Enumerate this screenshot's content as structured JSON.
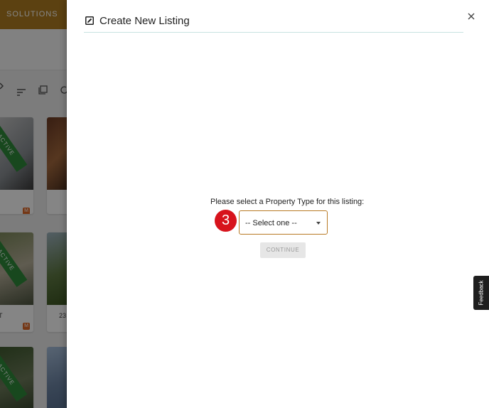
{
  "background": {
    "nav_label": "SOLUTIONS",
    "cards": [
      {
        "status": "ACTIVE",
        "meta": "®]"
      },
      {
        "status": "",
        "meta": ""
      },
      {
        "status": "ACTIVE",
        "meta": "T"
      },
      {
        "status": "",
        "meta": "23"
      },
      {
        "status": "ACTIVE",
        "meta": ""
      },
      {
        "status": "",
        "meta": ""
      }
    ]
  },
  "drawer": {
    "title": "Create New Listing",
    "prompt": "Please select a Property Type for this listing:",
    "step_number": "3",
    "select": {
      "selected": "-- Select one --"
    },
    "continue_label": "CONTINUE"
  },
  "feedback_label": "Feedback",
  "colors": {
    "brand": "#b07e22",
    "select_border": "#b87a25",
    "step_badge": "#d7131c",
    "status_ribbon": "#2e8b3a"
  }
}
